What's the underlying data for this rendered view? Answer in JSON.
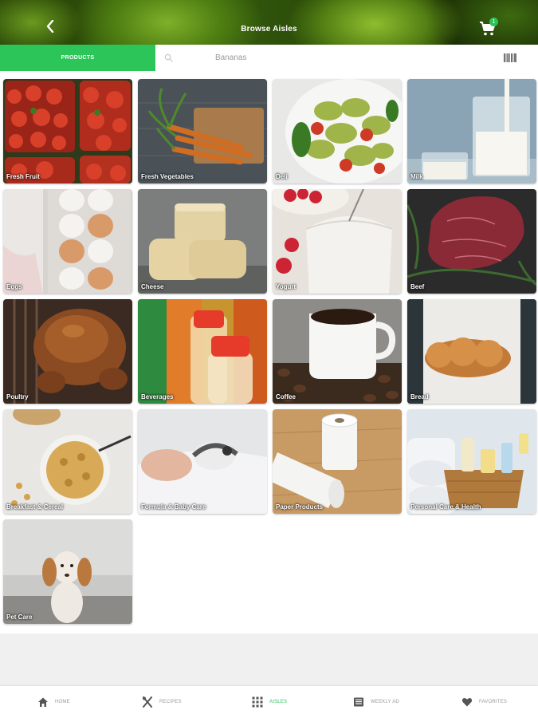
{
  "header": {
    "title": "Browse Aisles",
    "back_icon": "chevron-left-icon",
    "cart_icon": "cart-icon",
    "cart_count": "1"
  },
  "search": {
    "products_tab": "PRODUCTS",
    "placeholder": "Bananas",
    "search_icon": "search-icon",
    "barcode_icon": "barcode-icon"
  },
  "aisles": [
    {
      "label": "Fresh Fruit"
    },
    {
      "label": "Fresh Vegetables"
    },
    {
      "label": "Deli"
    },
    {
      "label": "Milk"
    },
    {
      "label": "Eggs"
    },
    {
      "label": "Cheese"
    },
    {
      "label": "Yogurt"
    },
    {
      "label": "Beef"
    },
    {
      "label": "Poultry"
    },
    {
      "label": "Beverages"
    },
    {
      "label": "Coffee"
    },
    {
      "label": "Bread"
    },
    {
      "label": "Breakfast & Cereal"
    },
    {
      "label": "Formula & Baby Care"
    },
    {
      "label": "Paper Products"
    },
    {
      "label": "Personal Care & Health"
    },
    {
      "label": "Pet Care"
    }
  ],
  "nav": {
    "home": "HOME",
    "recipes": "RECIPES",
    "aisles": "AISLES",
    "weekly_ad": "WEEKLY AD",
    "favorites": "FAVORITES",
    "active": "AISLES"
  },
  "colors": {
    "accent": "#2cc55a",
    "nav_inactive": "#9a9a9a"
  }
}
